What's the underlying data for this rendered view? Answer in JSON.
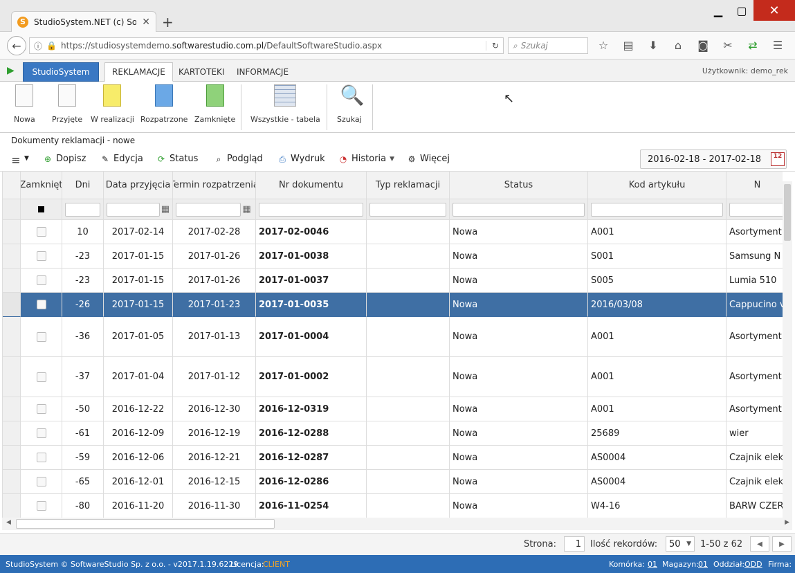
{
  "browser": {
    "tab_title": "StudioSystem.NET (c) Soft…",
    "favicon_letter": "S",
    "url_prefix": "https://studiosystemdemo.",
    "url_domain": "softwarestudio.com.pl",
    "url_path": "/DefaultSoftwareStudio.aspx",
    "search_placeholder": "Szukaj"
  },
  "app": {
    "studiosystem_label": "StudioSystem",
    "tabs": [
      "REKLAMACJE",
      "KARTOTEKI",
      "INFORMACJE"
    ],
    "user_label": "Użytkownik: demo_rek"
  },
  "ribbon": {
    "buttons": [
      "Nowa",
      "Przyjęte",
      "W realizacji",
      "Rozpatrzone",
      "Zamknięte",
      "Wszystkie - tabela",
      "Szukaj"
    ]
  },
  "section_title": "Dokumenty reklamacji - nowe",
  "toolbar": {
    "dopisz": "Dopisz",
    "edycja": "Edycja",
    "status": "Status",
    "podglad": "Podgląd",
    "wydruk": "Wydruk",
    "historia": "Historia",
    "wiecej": "Więcej",
    "date_range": "2016-02-18 - 2017-02-18"
  },
  "grid": {
    "headers": [
      "Zamknięt",
      "Dni",
      "Data przyjęcia",
      "Termin rozpatrzenia",
      "Nr dokumentu",
      "Typ reklamacji",
      "Status",
      "Kod artykułu",
      "N"
    ],
    "rows": [
      {
        "dni": "10",
        "data": "2017-02-14",
        "termin": "2017-02-28",
        "nr": "2017-02-0046",
        "typ": "",
        "status": "Nowa",
        "kod": "A001",
        "nazwa": "Asortyment"
      },
      {
        "dni": "-23",
        "data": "2017-01-15",
        "termin": "2017-01-26",
        "nr": "2017-01-0038",
        "typ": "",
        "status": "Nowa",
        "kod": "S001",
        "nazwa": "Samsung N"
      },
      {
        "dni": "-23",
        "data": "2017-01-15",
        "termin": "2017-01-26",
        "nr": "2017-01-0037",
        "typ": "",
        "status": "Nowa",
        "kod": "S005",
        "nazwa": "Lumia 510"
      },
      {
        "dni": "-26",
        "data": "2017-01-15",
        "termin": "2017-01-23",
        "nr": "2017-01-0035",
        "typ": "",
        "status": "Nowa",
        "kod": "2016/03/08",
        "nazwa": "Cappucino v"
      },
      {
        "dni": "-36",
        "data": "2017-01-05",
        "termin": "2017-01-13",
        "nr": "2017-01-0004",
        "typ": "",
        "status": "Nowa",
        "kod": "A001",
        "nazwa": "Asortyment"
      },
      {
        "dni": "-37",
        "data": "2017-01-04",
        "termin": "2017-01-12",
        "nr": "2017-01-0002",
        "typ": "",
        "status": "Nowa",
        "kod": "A001",
        "nazwa": "Asortyment"
      },
      {
        "dni": "-50",
        "data": "2016-12-22",
        "termin": "2016-12-30",
        "nr": "2016-12-0319",
        "typ": "",
        "status": "Nowa",
        "kod": "A001",
        "nazwa": "Asortyment"
      },
      {
        "dni": "-61",
        "data": "2016-12-09",
        "termin": "2016-12-19",
        "nr": "2016-12-0288",
        "typ": "",
        "status": "Nowa",
        "kod": "25689",
        "nazwa": "wier"
      },
      {
        "dni": "-59",
        "data": "2016-12-06",
        "termin": "2016-12-21",
        "nr": "2016-12-0287",
        "typ": "",
        "status": "Nowa",
        "kod": "AS0004",
        "nazwa": "Czajnik elek"
      },
      {
        "dni": "-65",
        "data": "2016-12-01",
        "termin": "2016-12-15",
        "nr": "2016-12-0286",
        "typ": "",
        "status": "Nowa",
        "kod": "AS0004",
        "nazwa": "Czajnik elek"
      },
      {
        "dni": "-80",
        "data": "2016-11-20",
        "termin": "2016-11-30",
        "nr": "2016-11-0254",
        "typ": "",
        "status": "Nowa",
        "kod": "W4-16",
        "nazwa": "BARW CZER"
      }
    ]
  },
  "pager": {
    "strona_label": "Strona:",
    "page": "1",
    "ilosc_label": "Ilość rekordów:",
    "per_page": "50",
    "range": "1-50 z 62"
  },
  "statusbar": {
    "copyright": "StudioSystem © SoftwareStudio Sp. z o.o. - v2017.1.19.6229",
    "licencja_label": "Licencja:",
    "licencja_value": "CLIENT",
    "komorka_label": "Komórka:",
    "komorka_value": "01",
    "magazyn_label": "Magazyn:",
    "magazyn_value": "01",
    "oddzial_label": "Oddział:",
    "oddzial_value": "ODD",
    "firma_label": "Firma:"
  },
  "colors": {
    "accent": "#3a78c3",
    "selected_row": "#3f6fa4",
    "statusbar": "#2d6db5"
  }
}
